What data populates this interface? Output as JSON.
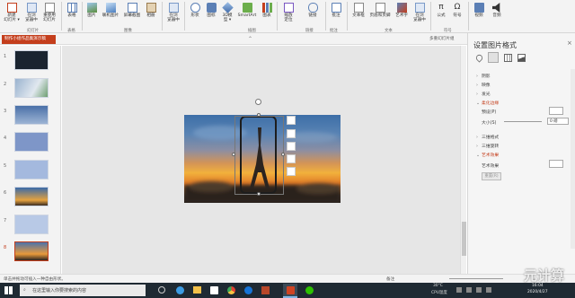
{
  "ribbon": {
    "buttons": [
      {
        "label": "新建\n幻灯片 ▾"
      },
      {
        "label": "在浏\n览器中"
      },
      {
        "label": "重使用\n幻灯片"
      },
      {
        "label": "表格"
      },
      {
        "label": "图片"
      },
      {
        "label": "联机图片"
      },
      {
        "label": "屏幕截图"
      },
      {
        "label": "相册"
      },
      {
        "label": "在浏\n览器中"
      },
      {
        "label": "形状"
      },
      {
        "label": "图标"
      },
      {
        "label": "3D模\n型 ▾"
      },
      {
        "label": "SmartArt"
      },
      {
        "label": "图表"
      },
      {
        "label": "缩放\n定位"
      },
      {
        "label": "链接"
      },
      {
        "label": "批注"
      },
      {
        "label": "文本框"
      },
      {
        "label": "页眉和页脚"
      },
      {
        "label": "艺术字"
      },
      {
        "label": "在浏\n览器中"
      },
      {
        "label": "公式"
      },
      {
        "label": "符号"
      },
      {
        "label": "视频"
      },
      {
        "label": "音频"
      }
    ],
    "group_labels": [
      "幻灯片",
      "表格",
      "图像",
      "插图",
      "链接",
      "批注",
      "文本",
      "符号"
    ]
  },
  "document": {
    "tab_title": "制作小组作品集演示稿"
  },
  "toolbar_hint": "多重幻灯片组",
  "slides": {
    "numbers": [
      "1",
      "2",
      "3",
      "4",
      "5",
      "6",
      "7",
      "8"
    ],
    "selected_index": 8
  },
  "format_pane": {
    "title": "设置图片格式",
    "close": "×",
    "sections": [
      {
        "label": "阴影",
        "open": false
      },
      {
        "label": "映像",
        "open": false
      },
      {
        "label": "发光",
        "open": false
      },
      {
        "label": "柔化边缘",
        "open": true
      },
      {
        "label": "三维格式",
        "open": false
      },
      {
        "label": "三维旋转",
        "open": false
      },
      {
        "label": "艺术效果",
        "open": true
      }
    ],
    "preset_label": "预设(P)",
    "size_label": "大小(S)",
    "size_value": "0 磅",
    "art_effect_label": "艺术效果",
    "reset_label": "重置(R)"
  },
  "status_bar": {
    "left_text": "单击并拖动可插入一种自由形状。",
    "zoom_text": "备注"
  },
  "taskbar": {
    "search_placeholder": "在这里输入你要搜索的内容",
    "temperature": "30°C",
    "cpu": "CPU温度",
    "time": "16:04",
    "date": "2020/4/27"
  },
  "watermark": "元计算"
}
